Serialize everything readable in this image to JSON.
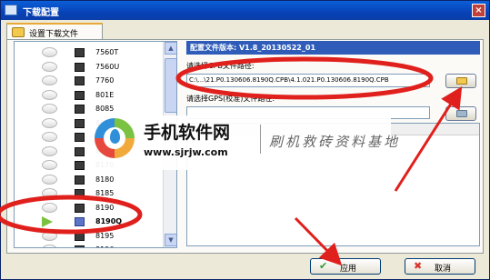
{
  "window": {
    "title": "下载配置",
    "close_glyph": "×"
  },
  "tab": {
    "label": "设置下载文件",
    "icon": "folder-plus-icon"
  },
  "models": {
    "items": [
      {
        "label": "7560T",
        "state": "idle"
      },
      {
        "label": "7560U",
        "state": "idle"
      },
      {
        "label": "7760",
        "state": "idle"
      },
      {
        "label": "801E",
        "state": "idle"
      },
      {
        "label": "8085",
        "state": "idle"
      },
      {
        "label": "8085",
        "state": "idle"
      },
      {
        "label": "8",
        "state": "idle"
      },
      {
        "label": "8",
        "state": "idle"
      },
      {
        "label": "8170",
        "state": "idle"
      },
      {
        "label": "8180",
        "state": "idle"
      },
      {
        "label": "8185",
        "state": "idle"
      },
      {
        "label": "8190",
        "state": "idle"
      },
      {
        "label": "8190Q",
        "state": "selected"
      },
      {
        "label": "8195",
        "state": "idle"
      },
      {
        "label": "8196",
        "state": "idle"
      }
    ],
    "scroll_up": "▲",
    "scroll_down": "▼"
  },
  "config": {
    "version_header": "配置文件版本: V1.8_20130522_01",
    "cpb_label": "请选择CPB文件路径:",
    "cpb_path": "C:\\...\\21.P0.130606.8190Q.CPB\\4.1.021.P0.130606.8190Q.CPB",
    "gps_label": "请选择GPS(校准)文件路径:",
    "gps_path": ""
  },
  "buttons": {
    "apply_label": "应用",
    "apply_icon": "✔",
    "cancel_label": "取消",
    "cancel_icon": "✖"
  },
  "watermark": {
    "title": "手机软件网",
    "url": "www.sjrjw.com",
    "slogan": "刷机救砖资料基地"
  },
  "colors": {
    "annotation_red": "#e0201c",
    "header_blue": "#2e5cb8",
    "play_green": "#7cc242"
  }
}
